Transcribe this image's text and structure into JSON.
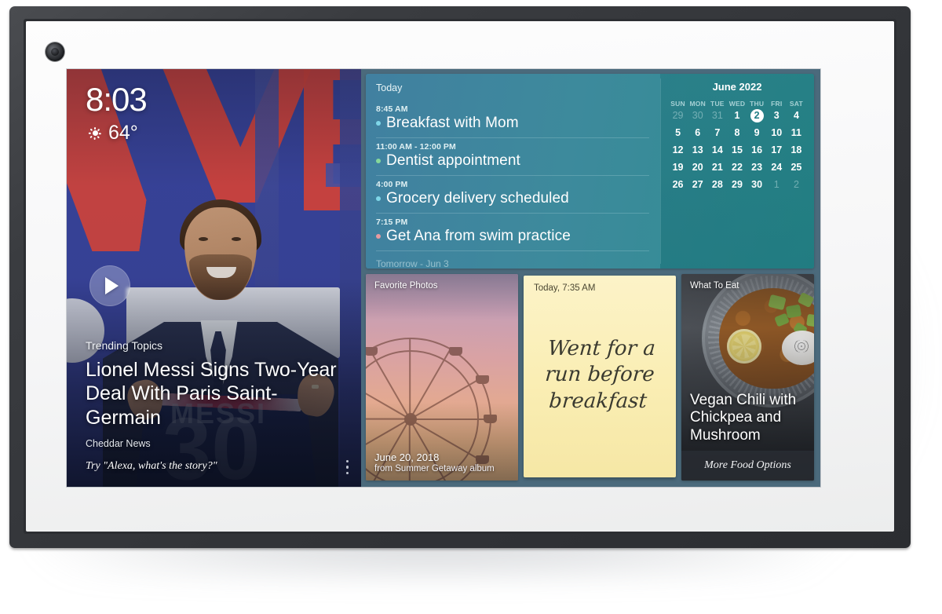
{
  "device": {
    "camera_icon": "camera-icon"
  },
  "clock": {
    "time": "8:03",
    "weather_icon": "sun-icon",
    "temperature": "64°"
  },
  "news": {
    "kicker": "Trending Topics",
    "headline": "Lionel Messi Signs Two-Year Deal With Paris Saint-Germain",
    "source": "Cheddar News",
    "hint": "Try \"Alexa, what's the story?\"",
    "play_icon": "play-icon",
    "more_icon": "more-vertical-icon",
    "jersey_name": "MESSI",
    "jersey_number": "30"
  },
  "agenda": {
    "header": "Today",
    "tomorrow_label": "Tomorrow - Jun 3",
    "items": [
      {
        "time": "8:45 AM",
        "title": "Breakfast with Mom",
        "dot_color": "#7fd6e8"
      },
      {
        "time": "11:00 AM - 12:00 PM",
        "title": "Dentist appointment",
        "dot_color": "#86d89a"
      },
      {
        "time": "4:00 PM",
        "title": "Grocery delivery scheduled",
        "dot_color": "#7fd6e8"
      },
      {
        "time": "7:15 PM",
        "title": "Get Ana from swim practice",
        "dot_color": "#e79aa0"
      }
    ]
  },
  "calendar": {
    "title": "June 2022",
    "day_names": [
      "SUN",
      "MON",
      "TUE",
      "WED",
      "THU",
      "FRI",
      "SAT"
    ],
    "today": 2,
    "weeks": [
      [
        {
          "d": "29",
          "m": true
        },
        {
          "d": "30",
          "m": true
        },
        {
          "d": "31",
          "m": true
        },
        {
          "d": "1",
          "m": false
        },
        {
          "d": "2",
          "m": false,
          "today": true
        },
        {
          "d": "3",
          "m": false
        },
        {
          "d": "4",
          "m": false
        }
      ],
      [
        {
          "d": "5",
          "m": false
        },
        {
          "d": "6",
          "m": false
        },
        {
          "d": "7",
          "m": false
        },
        {
          "d": "8",
          "m": false
        },
        {
          "d": "9",
          "m": false
        },
        {
          "d": "10",
          "m": false
        },
        {
          "d": "11",
          "m": false
        }
      ],
      [
        {
          "d": "12",
          "m": false
        },
        {
          "d": "13",
          "m": false
        },
        {
          "d": "14",
          "m": false
        },
        {
          "d": "15",
          "m": false
        },
        {
          "d": "16",
          "m": false
        },
        {
          "d": "17",
          "m": false
        },
        {
          "d": "18",
          "m": false
        }
      ],
      [
        {
          "d": "19",
          "m": false
        },
        {
          "d": "20",
          "m": false
        },
        {
          "d": "21",
          "m": false
        },
        {
          "d": "22",
          "m": false
        },
        {
          "d": "23",
          "m": false
        },
        {
          "d": "24",
          "m": false
        },
        {
          "d": "25",
          "m": false
        }
      ],
      [
        {
          "d": "26",
          "m": false
        },
        {
          "d": "27",
          "m": false
        },
        {
          "d": "28",
          "m": false
        },
        {
          "d": "29",
          "m": false
        },
        {
          "d": "30",
          "m": false
        },
        {
          "d": "1",
          "m": true
        },
        {
          "d": "2",
          "m": true
        }
      ]
    ]
  },
  "photo_card": {
    "label": "Favorite Photos",
    "date": "June 20, 2018",
    "album": "from Summer Getaway album"
  },
  "note_card": {
    "time": "Today, 7:35 AM",
    "text": "Went for a run before breakfast"
  },
  "food_card": {
    "label": "What To Eat",
    "title": "Vegan Chili with Chickpea and Mushroom",
    "more_label": "More Food Options"
  },
  "colors": {
    "accent_teal": "#2f8e91",
    "agenda_blue": "#4180a0",
    "note_yellow": "#faeeb4",
    "frame_dark": "#33353a"
  }
}
